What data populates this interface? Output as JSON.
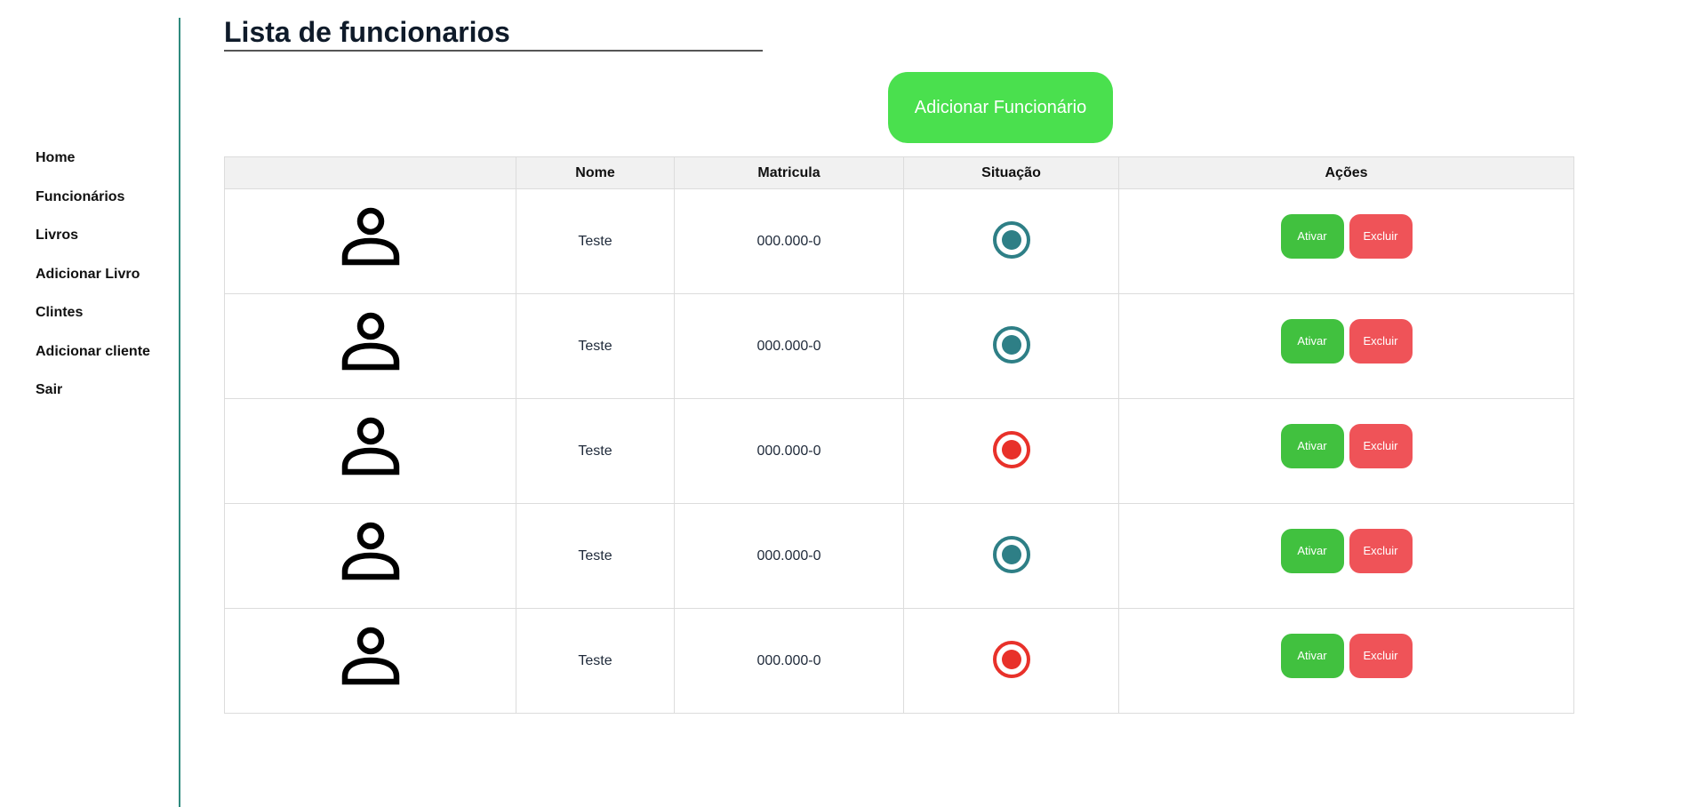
{
  "page": {
    "title": "Lista de funcionarios"
  },
  "sidebar": {
    "items": [
      {
        "label": "Home"
      },
      {
        "label": "Funcionários"
      },
      {
        "label": "Livros"
      },
      {
        "label": "Adicionar Livro"
      },
      {
        "label": "Clintes"
      },
      {
        "label": "Adicionar cliente"
      },
      {
        "label": "Sair"
      }
    ]
  },
  "toolbar": {
    "add_label": "Adicionar Funcionário"
  },
  "table": {
    "headers": [
      "",
      "Nome",
      "Matricula",
      "Situação",
      "Ações"
    ],
    "rows": [
      {
        "avatar_icon": "person-icon",
        "nome": "Teste",
        "matricula": "000.000-0",
        "situacao": "active",
        "ativar": "Ativar",
        "excluir": "Excluir"
      },
      {
        "avatar_icon": "person-icon",
        "nome": "Teste",
        "matricula": "000.000-0",
        "situacao": "active",
        "ativar": "Ativar",
        "excluir": "Excluir"
      },
      {
        "avatar_icon": "person-icon",
        "nome": "Teste",
        "matricula": "000.000-0",
        "situacao": "inactive",
        "ativar": "Ativar",
        "excluir": "Excluir"
      },
      {
        "avatar_icon": "person-icon",
        "nome": "Teste",
        "matricula": "000.000-0",
        "situacao": "active",
        "ativar": "Ativar",
        "excluir": "Excluir"
      },
      {
        "avatar_icon": "person-icon",
        "nome": "Teste",
        "matricula": "000.000-0",
        "situacao": "inactive",
        "ativar": "Ativar",
        "excluir": "Excluir"
      }
    ]
  },
  "colors": {
    "sidebar_line": "#2f8a7e",
    "add_button": "#4ae04e",
    "ativar_button": "#41c13f",
    "excluir_button": "#ef5358",
    "status_active": "#2e7f86",
    "status_inactive": "#e8312a"
  }
}
